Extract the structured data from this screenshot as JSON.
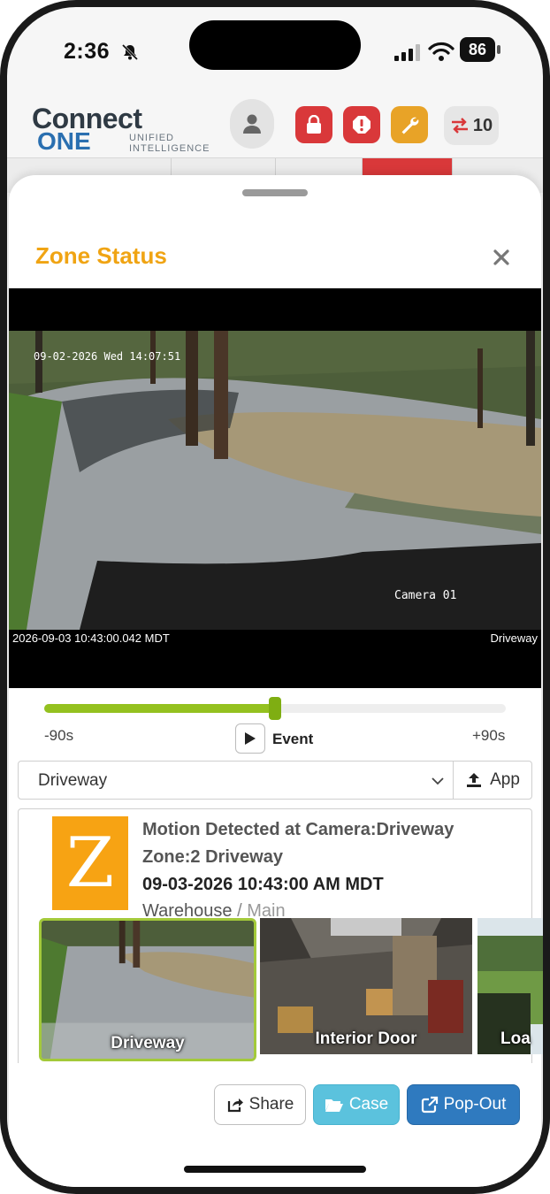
{
  "status_bar": {
    "time": "2:36",
    "battery": "86",
    "icons": [
      "bell-slash-icon",
      "signal-icon",
      "wifi-icon",
      "battery-icon"
    ]
  },
  "header": {
    "logo_main": "Connect",
    "logo_one": "ONE",
    "logo_sub_1": "UNIFIED",
    "logo_sub_2": "INTELLIGENCE",
    "swap_count": "10",
    "icons": [
      "user-icon",
      "lock-icon",
      "alert-icon",
      "wrench-icon",
      "swap-icon"
    ]
  },
  "sheet": {
    "title": "Zone Status"
  },
  "video": {
    "osd_top": "09-02-2026 Wed 14:07:51",
    "osd_camera": "Camera 01",
    "timestamp": "2026-09-03 10:43:00.042 MDT",
    "camera_name": "Driveway"
  },
  "timeline": {
    "start_label": "-90s",
    "end_label": "+90s",
    "event_label": "Event",
    "position": 0.5
  },
  "selector": {
    "value": "Driveway",
    "app_label": "App"
  },
  "event": {
    "icon_letter": "Z",
    "line1": "Motion Detected at Camera:Driveway",
    "line2": "Zone:2 Driveway",
    "date": "09-03-2026 10:43:00 AM MDT",
    "site": "Warehouse",
    "separator": " / ",
    "area": "Main"
  },
  "thumbnails": [
    {
      "label": "Driveway",
      "active": true
    },
    {
      "label": "Interior Door",
      "active": false
    },
    {
      "label": "Loa",
      "active": false
    }
  ],
  "actions": {
    "share": "Share",
    "case": "Case",
    "popout": "Pop-Out"
  },
  "colors": {
    "title": "#f0a413",
    "timeline_fill": "#94c11f",
    "case": "#5bc2dd",
    "popout": "#2f7abf",
    "alert_red": "#d9383a",
    "wrench_orange": "#e8a327"
  }
}
